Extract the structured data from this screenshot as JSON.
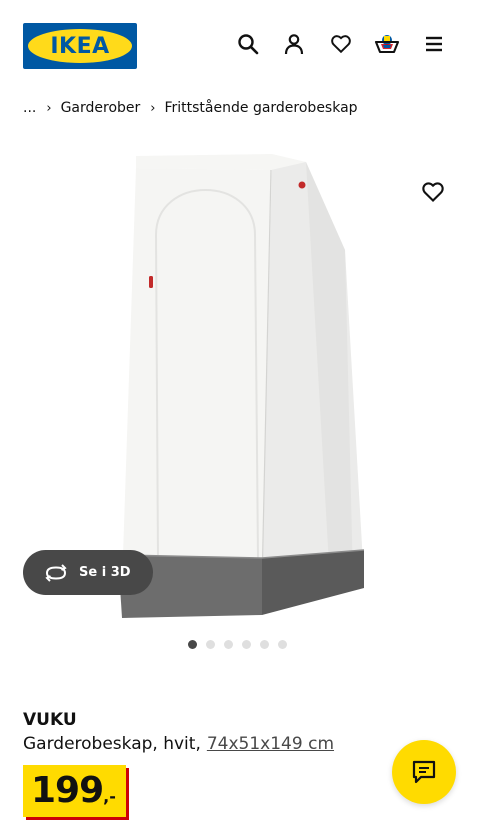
{
  "header": {
    "logo_text": "IKEA",
    "icons": [
      "search-icon",
      "account-icon",
      "heart-icon",
      "cart-icon",
      "menu-icon"
    ]
  },
  "breadcrumb": {
    "ellipsis": "...",
    "items": [
      "Garderober",
      "Frittstående garderobeskap"
    ]
  },
  "gallery": {
    "view3d_label": "Se i 3D",
    "slide_count": 6,
    "active_index": 0
  },
  "product": {
    "name": "VUKU",
    "description": "Garderobeskap, hvit,",
    "dimensions": "74x51x149 cm",
    "price": "199",
    "price_suffix": ",-"
  },
  "colors": {
    "brand_blue": "#0058a3",
    "brand_yellow": "#ffdb00",
    "price_shadow": "#cc0008",
    "button_dark": "#484848"
  }
}
